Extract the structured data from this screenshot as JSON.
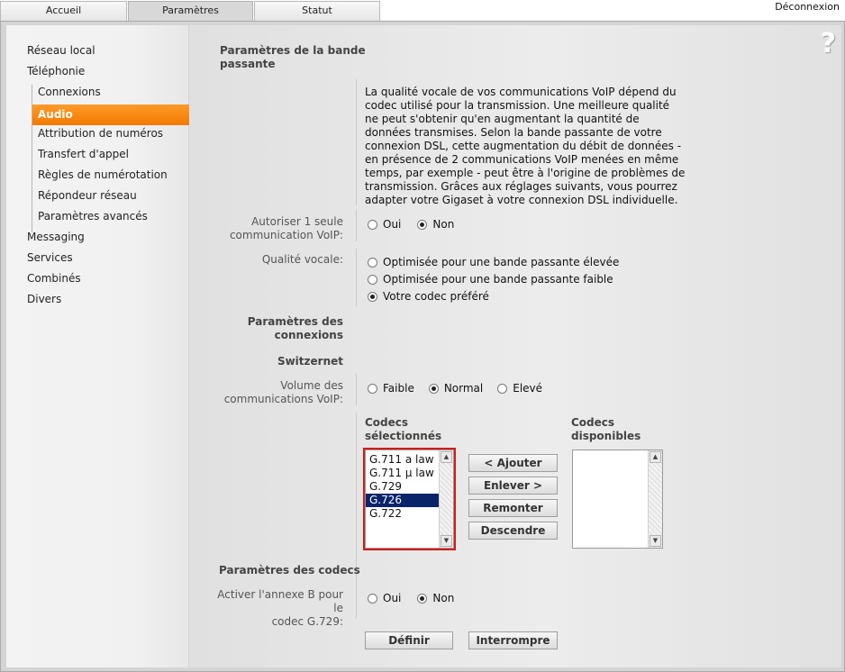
{
  "tabs": [
    "Accueil",
    "Paramètres",
    "Statut"
  ],
  "logout": "Déconnexion",
  "sidebar": {
    "items": [
      "Réseau local",
      "Téléphonie"
    ],
    "sub": [
      "Connexions",
      "Audio",
      "Attribution de numéros",
      "Transfert d'appel",
      "Règles de numérotation",
      "Répondeur réseau",
      "Paramètres avancés"
    ],
    "more": [
      "Messaging",
      "Services",
      "Combinés",
      "Divers"
    ]
  },
  "content": {
    "bandwidth_title_1": "Paramètres de la bande",
    "bandwidth_title_2": "passante",
    "intro": "La qualité vocale de vos communications VoIP dépend du codec utilisé pour la transmission. Une meilleure qualité ne peut s'obtenir qu'en augmentant la quantité de données transmises. Selon la bande passante de votre connexion DSL, cette augmentation du débit de données - en présence de 2 communications VoIP menées en même temps, par exemple - peut être à l'origine de problèmes de transmission. Grâces aux réglages suivants, vous pourrez adapter votre Gigaset à votre connexion DSL individuelle.",
    "allow_one_label_1": "Autoriser 1 seule",
    "allow_one_label_2": "communication VoIP:",
    "oui": "Oui",
    "non": "Non",
    "quality_label": "Qualité vocale:",
    "quality_opts": [
      "Optimisée pour une bande passante élevée",
      "Optimisée pour une bande passante faible",
      "Votre codec préféré"
    ],
    "conn_title_1": "Paramètres des",
    "conn_title_2": "connexions",
    "provider": "Switzernet",
    "volume_label_1": "Volume des",
    "volume_label_2": "communications VoIP:",
    "volume_opts": [
      "Faible",
      "Normal",
      "Elevé"
    ],
    "codecs_selected_1": "Codecs",
    "codecs_selected_2": "sélectionnés",
    "codecs_available_1": "Codecs",
    "codecs_available_2": "disponibles",
    "selected_codecs": [
      "G.711 a law",
      "G.711 µ law",
      "G.729",
      "G.726",
      "G.722"
    ],
    "selected_index": 3,
    "buttons": [
      "< Ajouter",
      "Enlever >",
      "Remonter",
      "Descendre"
    ],
    "codec_params_title": "Paramètres des codecs",
    "annexb_label_1": "Activer l'annexe B pour le",
    "annexb_label_2": "codec G.729:",
    "define": "Définir",
    "cancel": "Interrompre",
    "help": "?"
  },
  "colors": {
    "accent": "#f57f00",
    "selection": "#0a246a",
    "highlight_border": "#d41a1a"
  }
}
